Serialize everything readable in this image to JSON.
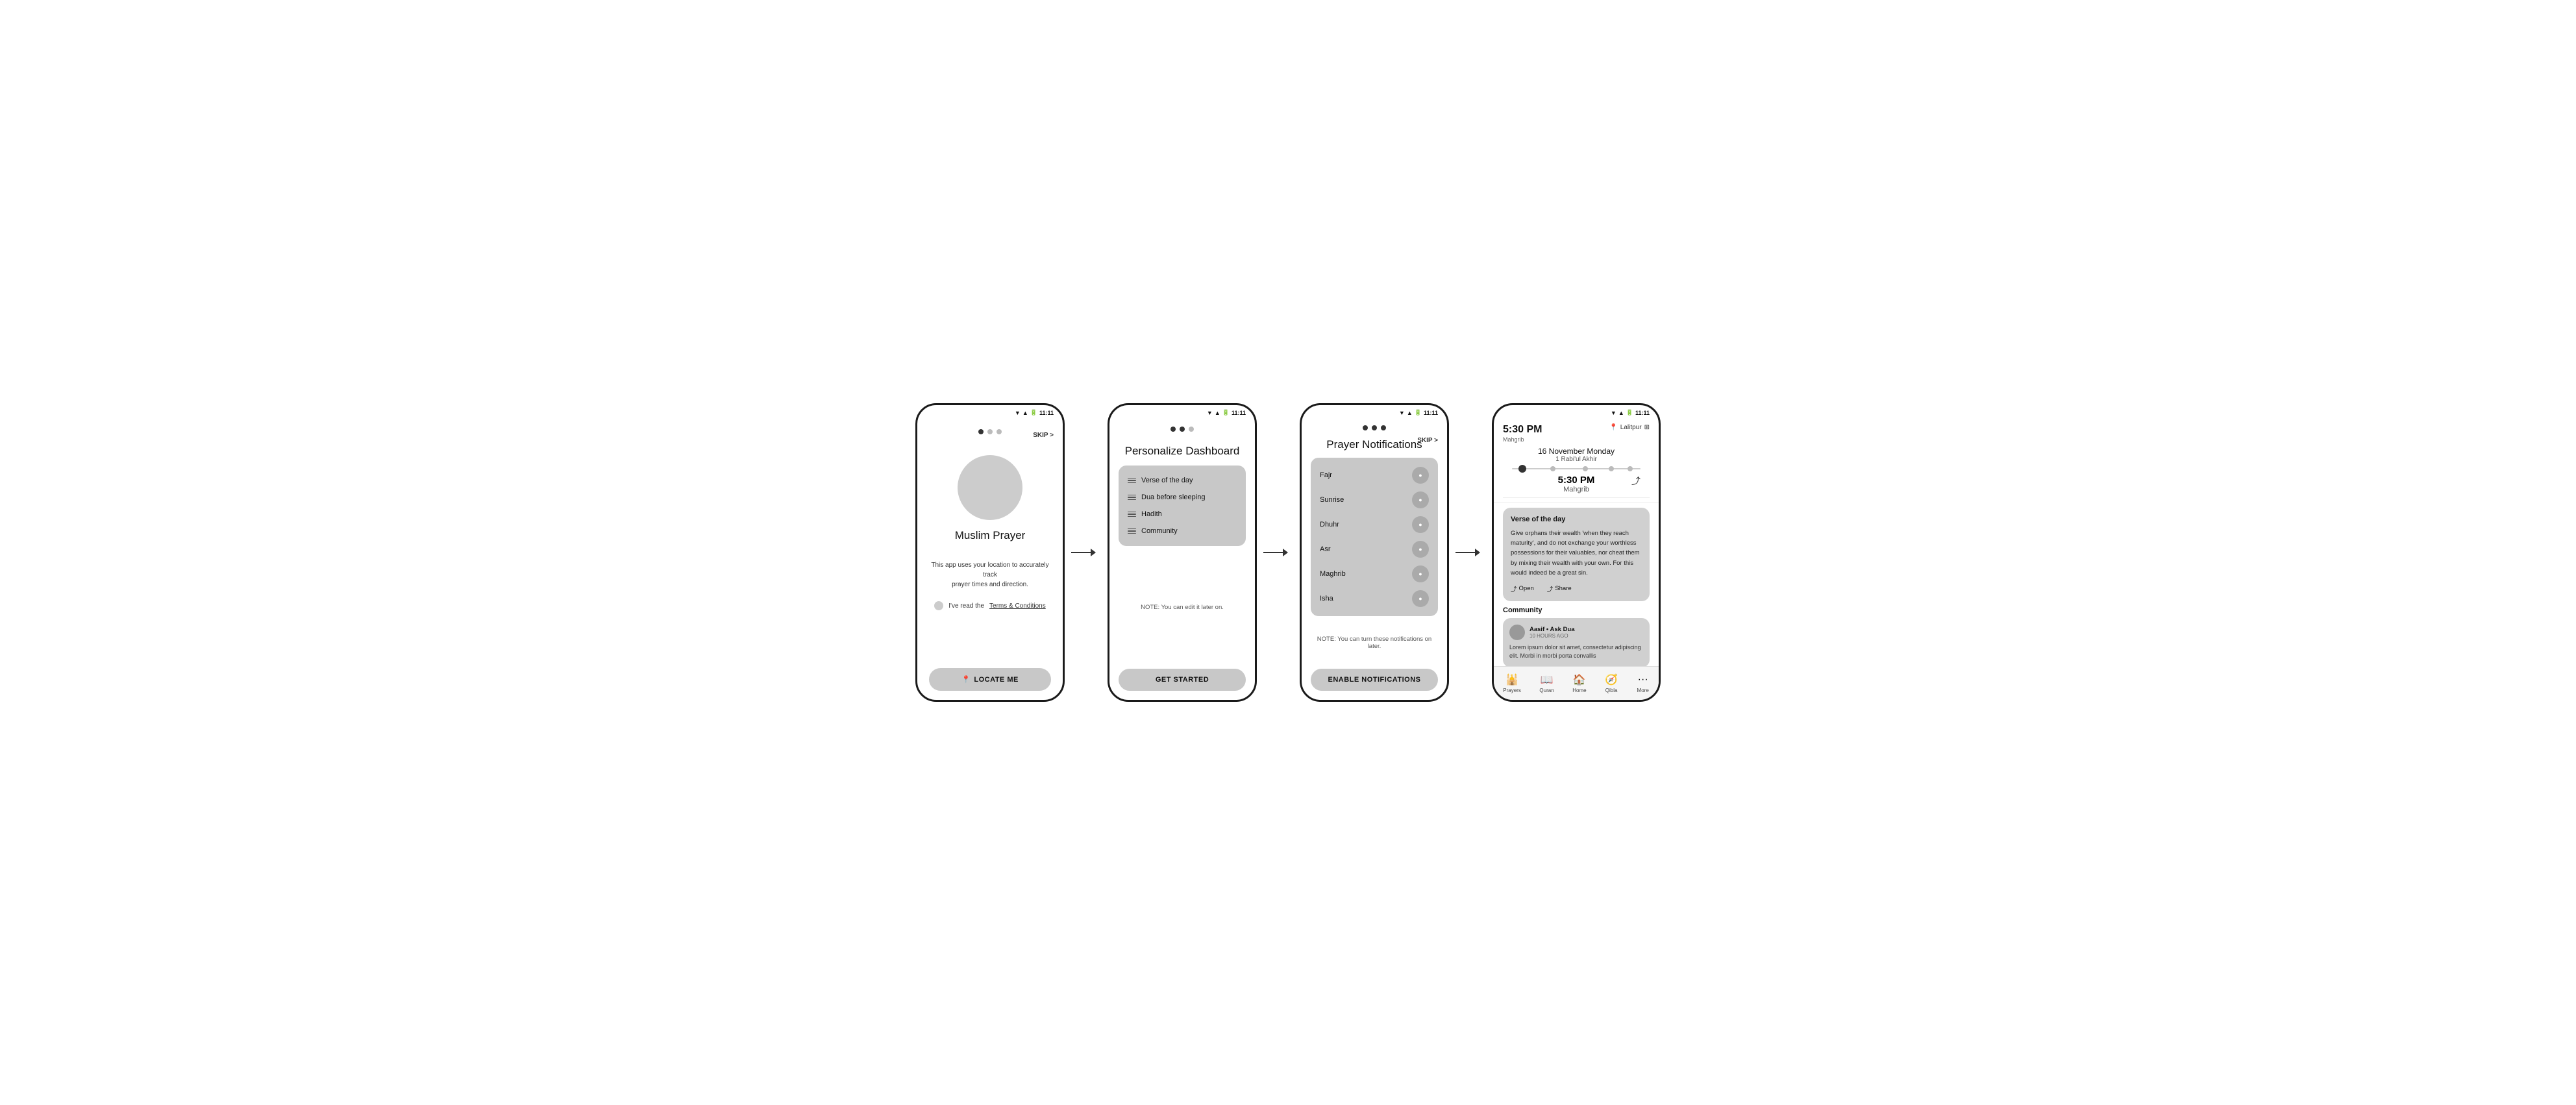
{
  "screens": [
    {
      "id": "screen1",
      "status_bar": {
        "time": "11:11"
      },
      "dots": [
        "active",
        "inactive",
        "inactive"
      ],
      "skip_label": "SKIP >",
      "avatar_placeholder": "",
      "app_title": "Muslim Prayer",
      "location_text": "This app uses your location to accurately track\nprayer times and direction.",
      "terms_label": "I've read the ",
      "terms_link": "Terms & Conditions",
      "cta_icon": "📍",
      "cta_label": "LOCATE ME"
    },
    {
      "id": "screen2",
      "status_bar": {
        "time": "11:11"
      },
      "dots": [
        "active",
        "active",
        "inactive"
      ],
      "title": "Personalize Dashboard",
      "items": [
        {
          "label": "Verse of the day"
        },
        {
          "label": "Dua before sleeping"
        },
        {
          "label": "Hadith"
        },
        {
          "label": "Community"
        }
      ],
      "note": "NOTE: You can edit it later on.",
      "cta_label": "GET STARTED"
    },
    {
      "id": "screen3",
      "status_bar": {
        "time": "11:11"
      },
      "dots": [
        "active",
        "active",
        "active"
      ],
      "skip_label": "SKIP >",
      "title": "Prayer Notifications",
      "prayers": [
        {
          "name": "Fajr"
        },
        {
          "name": "Sunrise"
        },
        {
          "name": "Dhuhr"
        },
        {
          "name": "Asr"
        },
        {
          "name": "Maghrib"
        },
        {
          "name": "Isha"
        }
      ],
      "note": "NOTE: You can turn these notifications on later.",
      "cta_label": "ENABLE NOTIFICATIONS"
    },
    {
      "id": "screen4",
      "status_bar": {
        "time": "11:11"
      },
      "prayer_time": "5:30 PM",
      "prayer_name": "Mahgrib",
      "location": "Lalitpur",
      "date_gregorian": "16 November Monday",
      "date_hijri": "1 Rabi'ul Akhir",
      "current_time": "5:30 PM",
      "current_prayer": "Mahgrib",
      "verse_title": "Verse of the day",
      "verse_text": "Give orphans their wealth 'when they reach maturity', and do not exchange your worthless possessions for their valuables, nor cheat them by mixing their wealth with your own. For this would indeed be a great sin.",
      "open_label": "Open",
      "share_label": "Share",
      "community_title": "Community",
      "community_user": "Aasif",
      "community_sub_label": "Ask Dua",
      "community_time": "10 HOURS AGO",
      "community_text": "Lorem ipsum dolor sit amet, consectetur adipiscing elit. Morbi in morbi porta convallis",
      "nav_items": [
        {
          "label": "Prayers",
          "icon": "🕌"
        },
        {
          "label": "Quran",
          "icon": "📖"
        },
        {
          "label": "Home",
          "icon": "🏠"
        },
        {
          "label": "Qibla",
          "icon": "🧭"
        },
        {
          "label": "More",
          "icon": "···"
        }
      ]
    }
  ],
  "conditions_label": "Conditions"
}
